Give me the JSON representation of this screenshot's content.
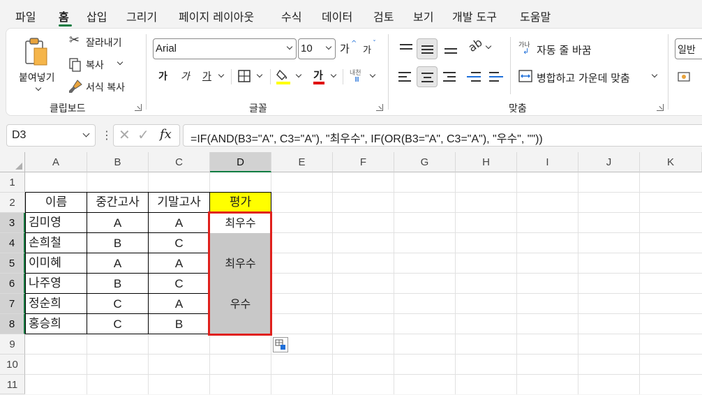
{
  "menu": {
    "tabs": [
      "파일",
      "홈",
      "삽입",
      "그리기",
      "페이지 레이아웃",
      "수식",
      "데이터",
      "검토",
      "보기",
      "개발 도구",
      "도움말"
    ],
    "active": "홈"
  },
  "ribbon": {
    "clipboard": {
      "paste": "붙여넣기",
      "cut": "잘라내기",
      "copy": "복사",
      "format_painter": "서식 복사",
      "label": "클립보드"
    },
    "font": {
      "font_name": "Arial",
      "font_size": "10",
      "grow_glyph": "가",
      "shrink_glyph": "가",
      "bold": "가",
      "italic": "가",
      "underline": "가",
      "fill_color": "#ffff00",
      "font_color_glyph": "가",
      "phonetic_top": "내천",
      "label": "글꼴"
    },
    "alignment": {
      "wrap_text": "자동 줄 바꿈",
      "wrap_icon_text": "가나",
      "merge_center": "병합하고 가운데 맞춤",
      "label": "맞춤"
    },
    "number": {
      "format": "일반"
    }
  },
  "formula_bar": {
    "name_box": "D3",
    "fx": "fx",
    "formula": "=IF(AND(B3=\"A\", C3=\"A\"), \"최우수\", IF(OR(B3=\"A\", C3=\"A\"), \"우수\", \"\"))"
  },
  "sheet": {
    "columns": [
      "A",
      "B",
      "C",
      "D",
      "E",
      "F",
      "G",
      "H",
      "I",
      "J",
      "K"
    ],
    "rows": [
      "1",
      "2",
      "3",
      "4",
      "5",
      "6",
      "7",
      "8",
      "9",
      "10",
      "11"
    ],
    "selected_column": "D",
    "header": [
      "이름",
      "중간고사",
      "기말고사",
      "평가"
    ],
    "data": [
      [
        "김미영",
        "A",
        "A",
        "최우수"
      ],
      [
        "손희철",
        "B",
        "C",
        ""
      ],
      [
        "이미혜",
        "A",
        "A",
        "최우수"
      ],
      [
        "나주영",
        "B",
        "C",
        ""
      ],
      [
        "정순희",
        "C",
        "A",
        "우수"
      ],
      [
        "홍승희",
        "C",
        "B",
        ""
      ]
    ],
    "header_fill": "#ffff00",
    "selection_fill": "#c8c8c8",
    "selection_border": "#e0201c"
  }
}
